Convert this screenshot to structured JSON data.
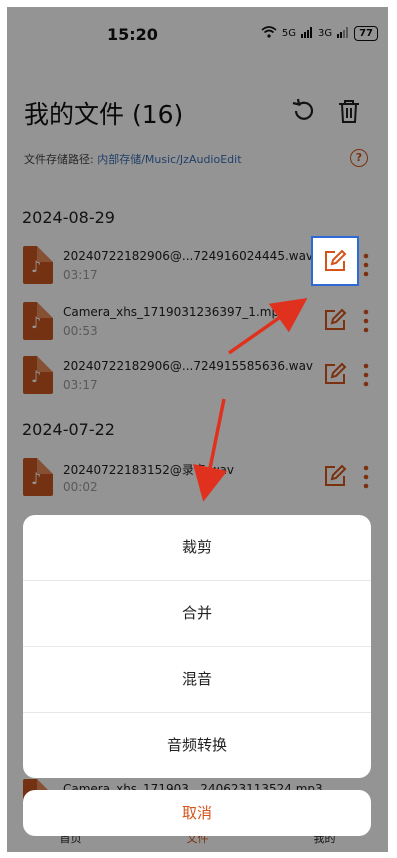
{
  "status": {
    "time": "15:20",
    "signal1": "5G",
    "signal2": "3G",
    "battery": "77"
  },
  "header": {
    "title": "我的文件 (16)",
    "path_label": "文件存储路径:",
    "path_value": "内部存储/Music/JzAudioEdit"
  },
  "groups": [
    {
      "date": "2024-08-29"
    },
    {
      "date": "2024-07-22"
    }
  ],
  "files": [
    {
      "name": "20240722182906@...724916024445.wav",
      "duration": "03:17"
    },
    {
      "name": "Camera_xhs_1719031236397_1.mp3",
      "duration": "00:53"
    },
    {
      "name": "20240722182906@...724915585636.wav",
      "duration": "03:17"
    },
    {
      "name": "20240722183152@录音.wav",
      "duration": "00:02"
    },
    {
      "name": "Camera_xhs_171903...240623113524.mp3",
      "duration": ""
    }
  ],
  "sheet": {
    "items": [
      "裁剪",
      "合并",
      "混音",
      "音频转换"
    ],
    "cancel": "取消"
  },
  "nav": {
    "home": "首页",
    "files": "文件",
    "mine": "我的"
  },
  "colors": {
    "accent": "#d4541a",
    "highlight": "#2e6ad6",
    "arrow": "#e0311e"
  }
}
